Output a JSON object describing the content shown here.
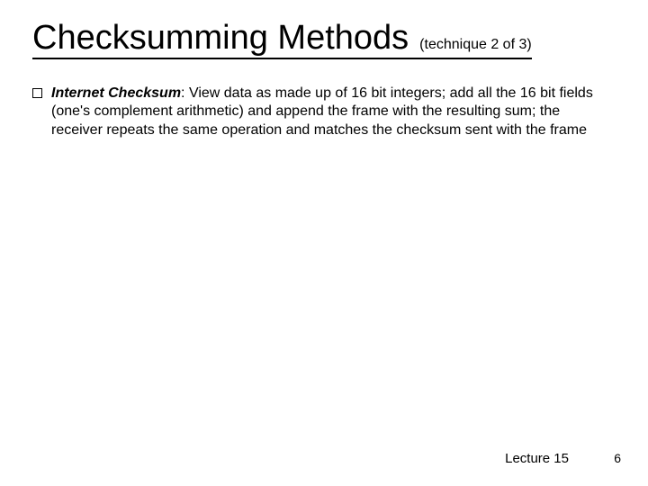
{
  "title": {
    "main": "Checksumming Methods",
    "sub": "(technique 2 of 3)"
  },
  "body": {
    "bullet1_strong": "Internet Checksum",
    "bullet1_rest": ": View data as made up of 16 bit integers; add all the 16 bit fields (one's complement arithmetic) and append the frame with the resulting sum; the receiver repeats the same operation and matches the checksum sent with the frame"
  },
  "footer": {
    "lecture": "Lecture 15",
    "page": "6"
  }
}
